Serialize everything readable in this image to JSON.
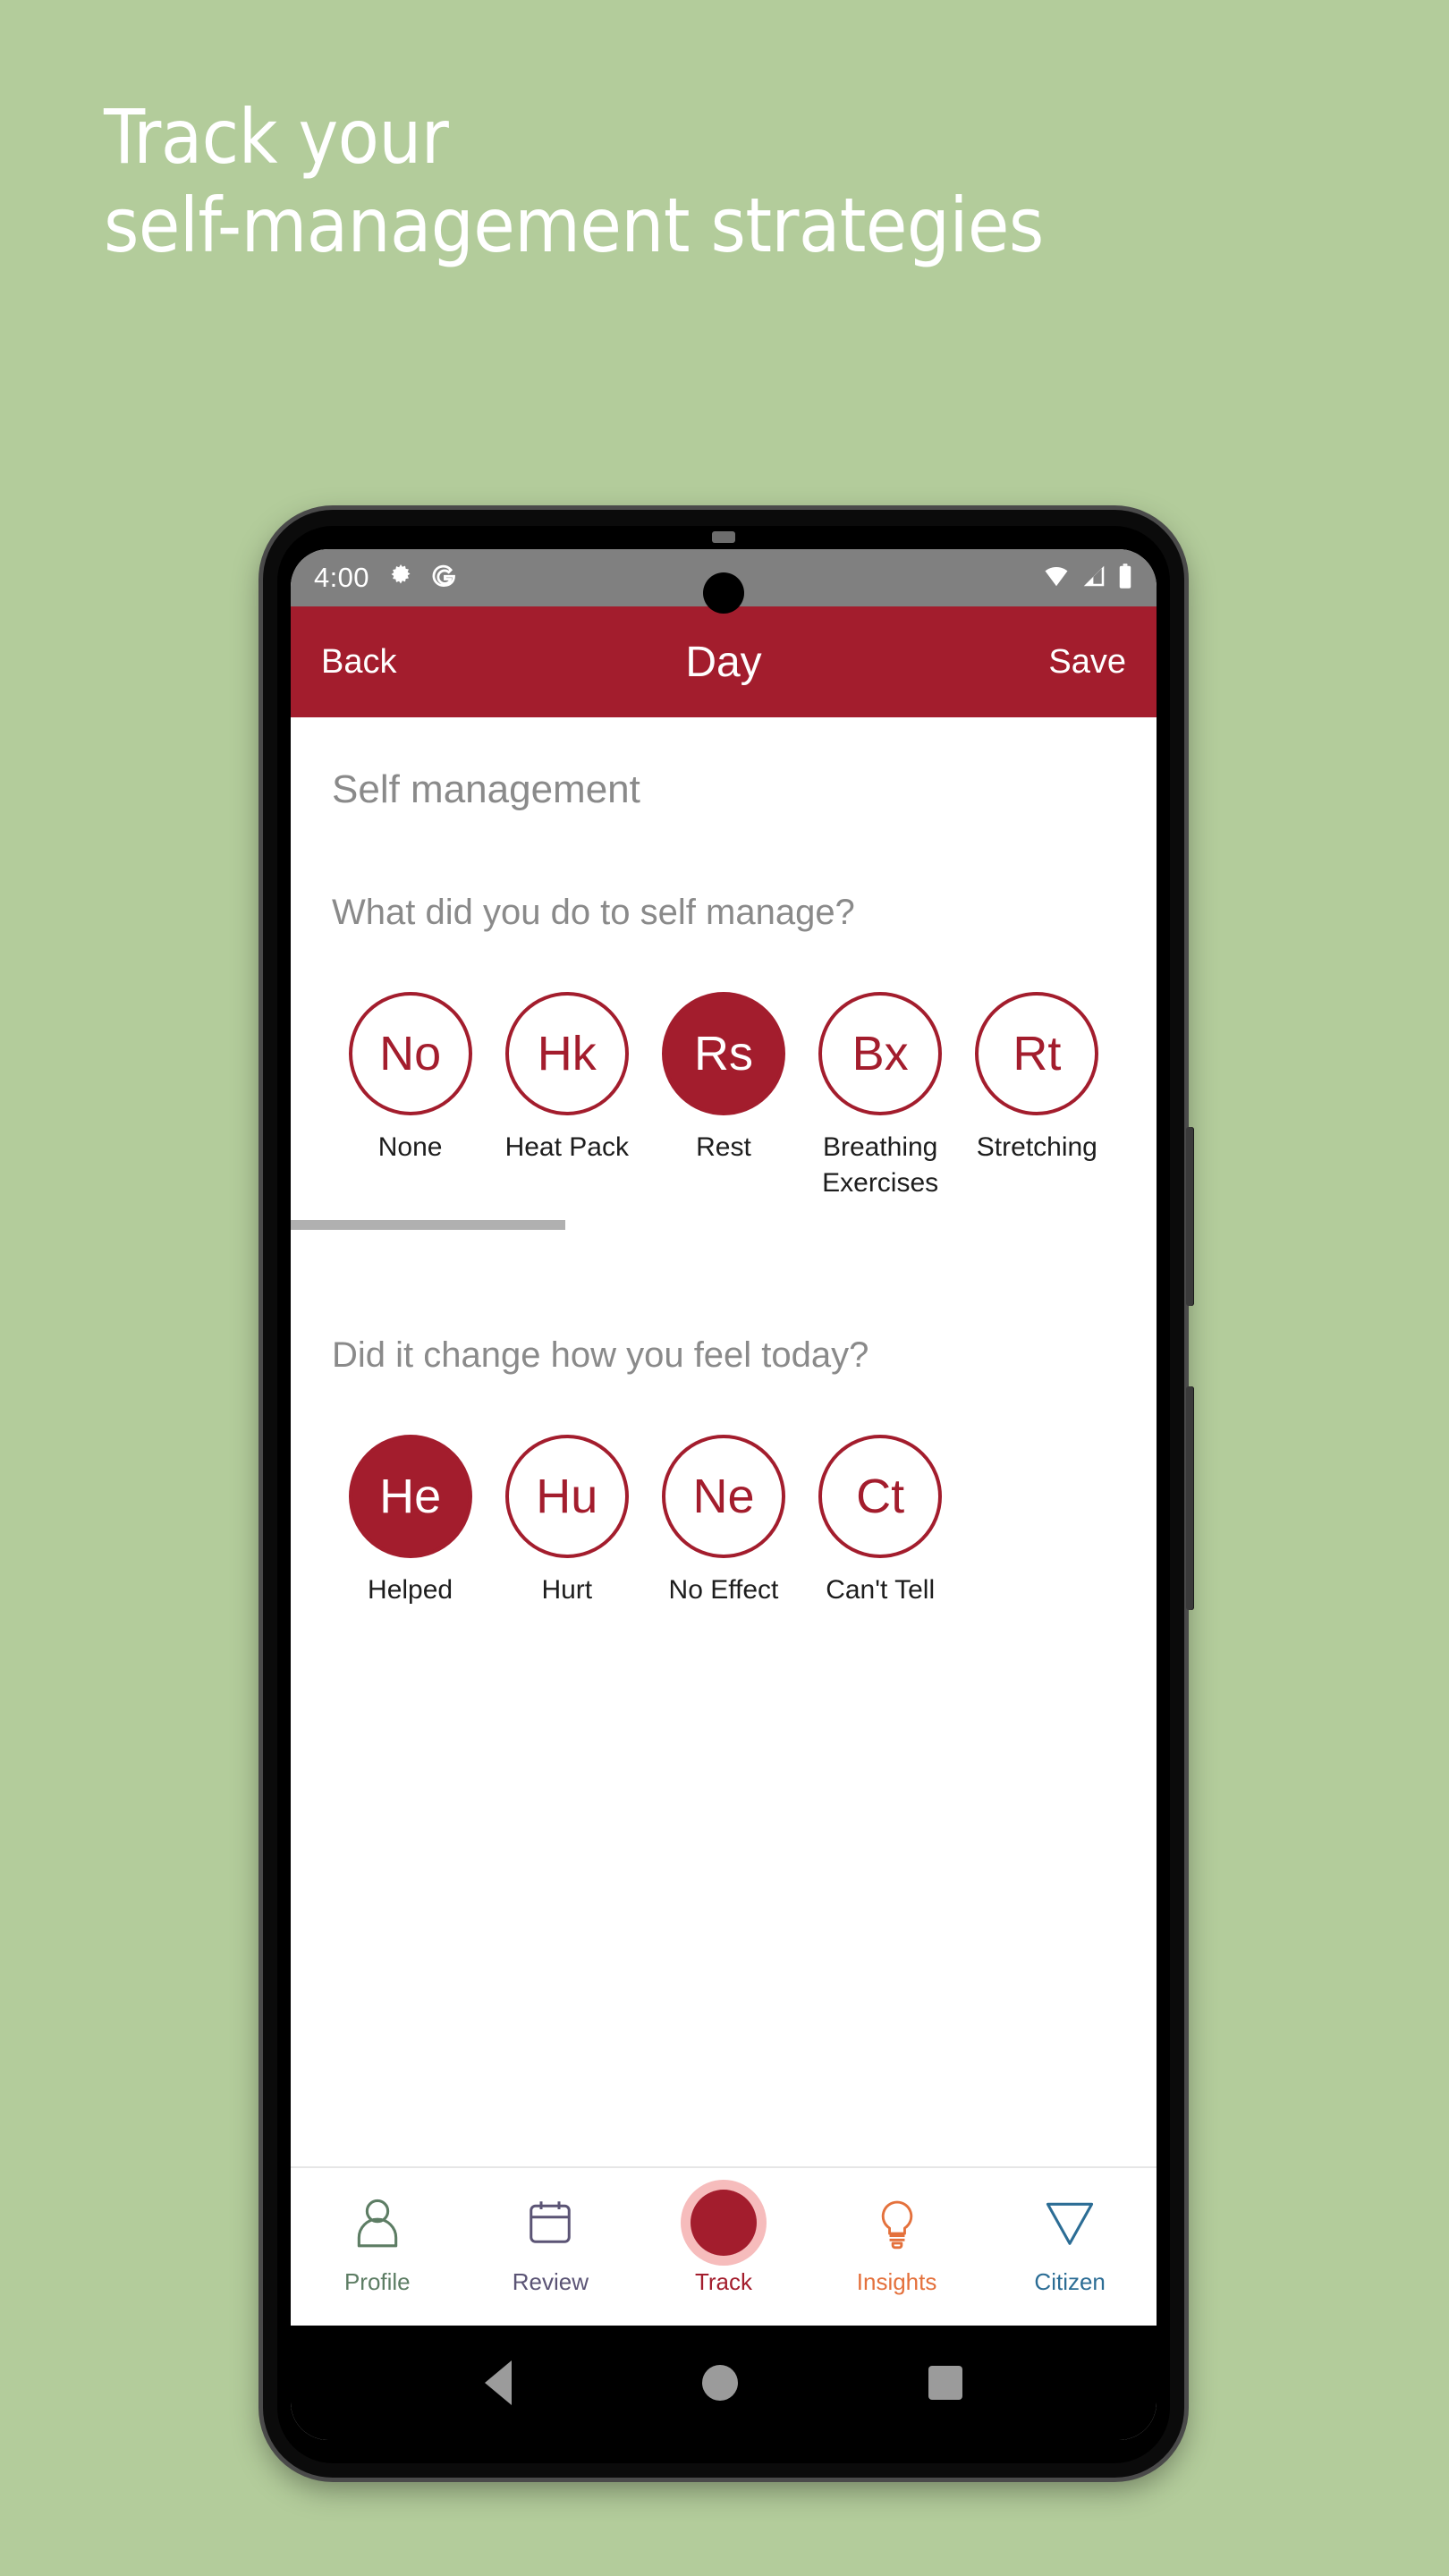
{
  "promo": {
    "line1": "Track your",
    "line2": "self-management strategies"
  },
  "colors": {
    "background": "#b3cc9b",
    "brand_crimson": "#a31d2d",
    "status_bar": "#808080",
    "profile_green": "#5d7d64",
    "review_purple": "#5b5475",
    "insights_orange": "#e4713c",
    "citizen_blue": "#2c6d95",
    "track_halo_pink": "#f6bcbc"
  },
  "status_bar": {
    "time": "4:00",
    "icons_left": [
      "gear-icon",
      "google-g-icon"
    ],
    "icons_right": [
      "wifi-icon",
      "cellular-signal-icon",
      "battery-icon"
    ]
  },
  "app_bar": {
    "back_label": "Back",
    "title": "Day",
    "save_label": "Save"
  },
  "content": {
    "section_title": "Self management",
    "question_1": "What did you do to self manage?",
    "options_1": [
      {
        "abbr": "No",
        "label": "None",
        "selected": false
      },
      {
        "abbr": "Hk",
        "label": "Heat Pack",
        "selected": false
      },
      {
        "abbr": "Rs",
        "label": "Rest",
        "selected": true
      },
      {
        "abbr": "Bx",
        "label": "Breathing Exercises",
        "selected": false
      },
      {
        "abbr": "Rt",
        "label": "Stretching",
        "selected": false
      }
    ],
    "question_2": "Did it change how you feel today?",
    "options_2": [
      {
        "abbr": "He",
        "label": "Helped",
        "selected": true
      },
      {
        "abbr": "Hu",
        "label": "Hurt",
        "selected": false
      },
      {
        "abbr": "Ne",
        "label": "No Effect",
        "selected": false
      },
      {
        "abbr": "Ct",
        "label": "Can't Tell",
        "selected": false
      }
    ],
    "scroll_position_percent": 0
  },
  "bottom_nav": {
    "items": [
      {
        "label": "Profile",
        "icon": "person-icon",
        "active": false
      },
      {
        "label": "Review",
        "icon": "calendar-icon",
        "active": false
      },
      {
        "label": "Track",
        "icon": "circle-icon",
        "active": true
      },
      {
        "label": "Insights",
        "icon": "lightbulb-icon",
        "active": false
      },
      {
        "label": "Citizen",
        "icon": "triangle-down-icon",
        "active": false
      }
    ]
  },
  "android_nav": {
    "back": "back-triangle-icon",
    "home": "home-circle-icon",
    "recents": "recents-square-icon"
  }
}
